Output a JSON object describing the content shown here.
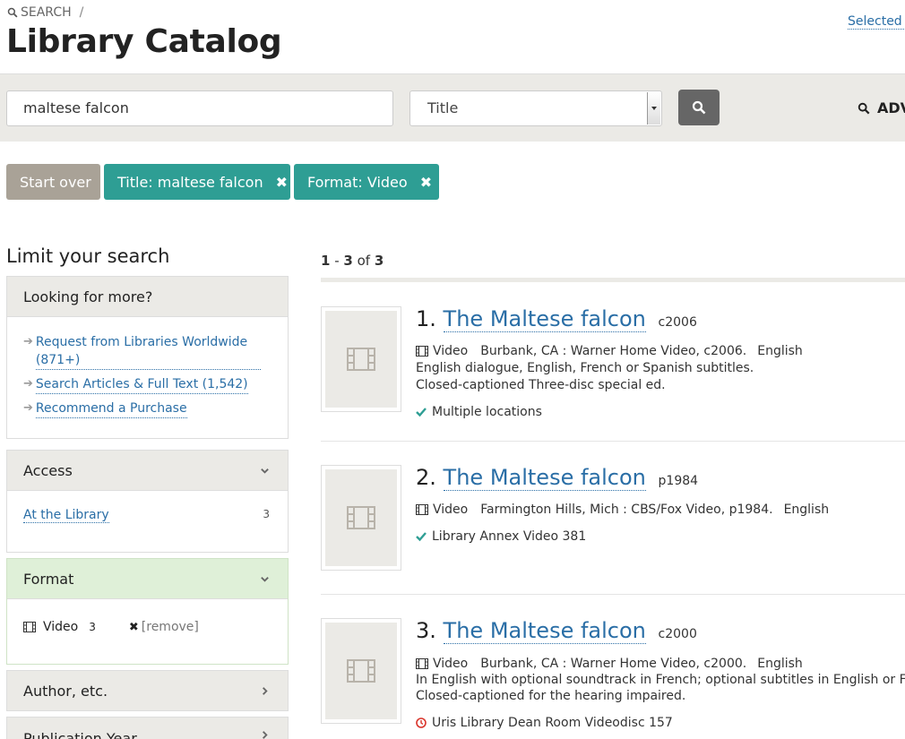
{
  "breadcrumb": {
    "search_label": "SEARCH",
    "separator": "/"
  },
  "header": {
    "title": "Library Catalog",
    "selected_link": "Selected I"
  },
  "search": {
    "query": "maltese falcon",
    "field_selected": "Title",
    "advanced_label": "ADV"
  },
  "constraints": {
    "start_over": "Start over",
    "filters": [
      {
        "label": "Title: maltese falcon"
      },
      {
        "label": "Format: Video"
      }
    ]
  },
  "sidebar": {
    "title": "Limit your search",
    "looking_for_more": {
      "heading": "Looking for more?",
      "links": [
        {
          "label": "Request from Libraries Worldwide (871+)"
        },
        {
          "label": "Search Articles & Full Text (1,542)"
        },
        {
          "label": "Recommend a Purchase"
        }
      ]
    },
    "access": {
      "heading": "Access",
      "items": [
        {
          "label": "At the Library",
          "count": "3"
        }
      ]
    },
    "format": {
      "heading": "Format",
      "items": [
        {
          "label": "Video",
          "count": "3",
          "remove": "[remove]"
        }
      ]
    },
    "author": {
      "heading": "Author, etc."
    },
    "pubyear": {
      "heading": "Publication Year"
    }
  },
  "results": {
    "count_start": "1",
    "count_dash": " - ",
    "count_end": "3",
    "count_of": " of ",
    "count_total": "3",
    "items": [
      {
        "num": "1.",
        "title": "The Maltese falcon",
        "date": "c2006",
        "format": "Video",
        "pub": "Burbank, CA : Warner Home Video, c2006.",
        "lang": "English",
        "notes": [
          "English dialogue, English, French or Spanish subtitles.",
          "Closed-captioned Three-disc special ed."
        ],
        "availability": "Multiple locations",
        "status": "available"
      },
      {
        "num": "2.",
        "title": "The Maltese falcon",
        "date": "p1984",
        "format": "Video",
        "pub": "Farmington Hills, Mich : CBS/Fox Video, p1984.",
        "lang": "English",
        "notes": [],
        "availability": "Library Annex Video 381",
        "status": "available"
      },
      {
        "num": "3.",
        "title": "The Maltese falcon",
        "date": "c2000",
        "format": "Video",
        "pub": "Burbank, CA : Warner Home Video, c2000.",
        "lang": "English",
        "notes": [
          "In English with optional soundtrack in French; optional subtitles in English or French.",
          "Closed-captioned for the hearing impaired."
        ],
        "availability": "Uris Library Dean Room Videodisc 157",
        "status": "checked-out"
      }
    ]
  },
  "colors": {
    "teal": "#2e9e94",
    "link": "#2a6ea6",
    "start_over": "#a9a297",
    "check": "#2e9e94",
    "unavailable": "#d9342b"
  }
}
